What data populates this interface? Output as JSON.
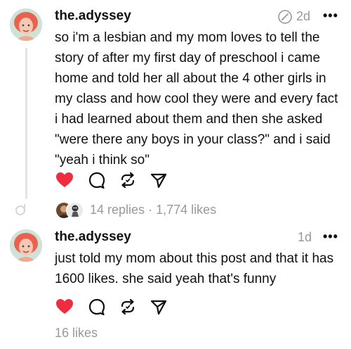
{
  "posts": [
    {
      "username": "the.adyssey",
      "time": "2d",
      "more": "•••",
      "text": "so i'm a lesbian and my mom loves to tell the story of after my first day of preschool i came home and told her all about the 4 other girls in my class and how cool they were and every fact i had learned about them and then she asked \"were there any boys in your class?\" and i said \"yeah i think so\"",
      "replies": "14 replies",
      "separator": "·",
      "likes": "1,774 likes",
      "liked": true
    },
    {
      "username": "the.adyssey",
      "time": "1d",
      "more": "•••",
      "text": "just told my mom about this post and that it has 1600 likes. she said yeah that's funny",
      "likes": "16 likes",
      "liked": true
    }
  ],
  "colors": {
    "heart": "#ef2c40",
    "muted": "#999999",
    "text": "#101010"
  },
  "icons": [
    "edited-icon",
    "heart-icon",
    "comment-icon",
    "repost-icon",
    "share-icon",
    "thread-loop-icon"
  ]
}
